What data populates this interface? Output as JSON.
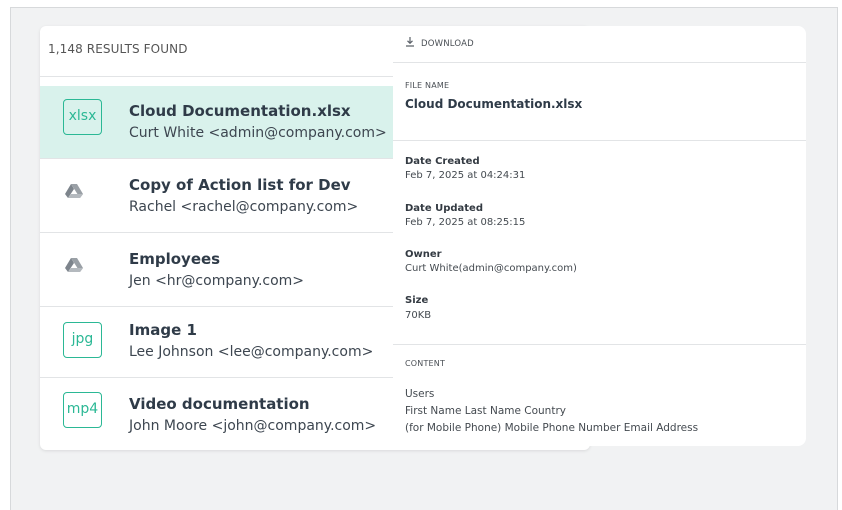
{
  "results": {
    "count_label": "1,148 RESULTS FOUND",
    "items": [
      {
        "type": "xlsx",
        "badge": "xlsx",
        "title": "Cloud Documentation.xlsx",
        "sub": "Curt White <admin@company.com>",
        "selected": true
      },
      {
        "type": "drive",
        "icon": "google-drive-icon",
        "title": "Copy of Action list for Dev",
        "sub": "Rachel <rachel@company.com>",
        "selected": false
      },
      {
        "type": "drive",
        "icon": "google-drive-icon",
        "title": "Employees",
        "sub": "Jen <hr@company.com>",
        "selected": false
      },
      {
        "type": "jpg",
        "badge": "jpg",
        "title": "Image 1",
        "sub": "Lee Johnson <lee@company.com>",
        "selected": false
      },
      {
        "type": "mp4",
        "badge": "mp4",
        "title": "Video documentation",
        "sub": "John Moore <john@company.com>",
        "selected": false
      }
    ]
  },
  "details": {
    "download_label": "DOWNLOAD",
    "file_name_label": "FILE NAME",
    "file_name": "Cloud Documentation.xlsx",
    "date_created_label": "Date Created",
    "date_created": "Feb 7, 2025 at 04:24:31",
    "date_updated_label": "Date Updated",
    "date_updated": "Feb 7, 2025 at 08:25:15",
    "owner_label": "Owner",
    "owner": "Curt White(admin@company.com)",
    "size_label": "Size",
    "size": "70KB",
    "content_label": "CONTENT",
    "content_lines": [
      "Users",
      "First Name Last Name Country",
      "(for Mobile Phone) Mobile Phone Number Email Address"
    ]
  },
  "colors": {
    "accent": "#2bb895",
    "selected_row": "#d9f2ec",
    "background": "#f1f2f3"
  }
}
